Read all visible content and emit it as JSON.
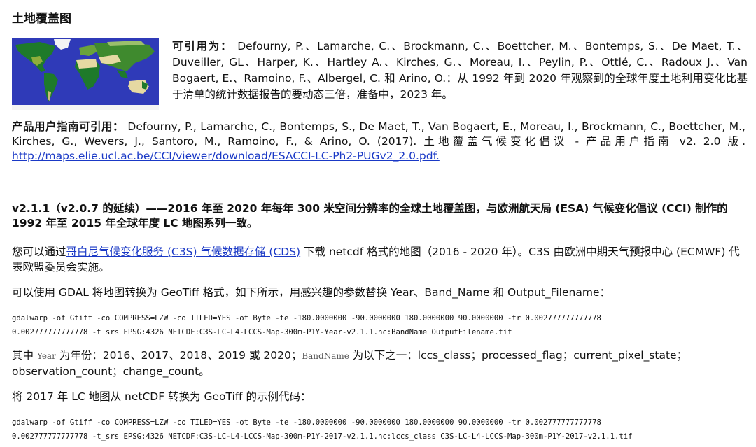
{
  "title": "土地覆盖图",
  "citation": {
    "label": "可引用为：",
    "text": "Defourny, P.、Lamarche, C.、Brockmann, C.、Boettcher, M.、Bontemps, S.、De Maet, T.、Duveiller, GL、Harper, K.、Hartley A.、Kirches, G.、Moreau, I.、Peylin, P.、Ottlé, C.、Radoux J.、Van Bogaert, E.、Ramoino, F.、Albergel, C. 和 Arino, O.：从 1992 年到 2020 年观察到的全球年度土地利用变化比基于清单的统计数据报告的要动态三倍，准备中，2023 年。"
  },
  "guide_citation": {
    "label": "产品用户指南可引用：",
    "text": " Defourny, P., Lamarche, C., Bontemps, S., De Maet, T., Van Bogaert, E., Moreau, I., Brockmann, C., Boettcher, M., Kirches, G., Wevers, J., Santoro, M., Ramoino, F., & Arino, O. (2017). 土地覆盖气候变化倡议 - 产品用户指南 v2. 2.0 版. ",
    "link": "http://maps.elie.ucl.ac.be/CCI/viewer/download/ESACCI-LC-Ph2-PUGv2_2.0.pdf."
  },
  "heading": "v2.1.1（v2.0.7 的延续）——2016 年至 2020 年每年 300 米空间分辨率的全球土地覆盖图，与欧洲航天局 (ESA) 气候变化倡议 (CCI) 制作的 1992 年至 2015 年全球年度 LC 地图系列一致。",
  "download": {
    "prefix": "您可以通过",
    "link": "哥白尼气候变化服务 (C3S) 气候数据存储 (CDS)",
    "suffix": " 下载 netcdf 格式的地图（2016 - 2020 年）。C3S 由欧洲中期天气预报中心 (ECMWF) 代表欧盟委员会实施。"
  },
  "gdal_intro": "可以使用 GDAL 将地图转换为 GeoTiff 格式，如下所示，用感兴趣的参数替换 Year、Band_Name 和 Output_Filename：",
  "code1": {
    "line1": "gdalwarp -of Gtiff -co COMPRESS=LZW -co TILED=YES -ot Byte -te -180.0000000 -90.0000000 180.0000000 90.0000000 -tr 0.002777777777778",
    "line2": "0.002777777777778 -t_srs EPSG:4326 NETCDF:C3S-LC-L4-LCCS-Map-300m-P1Y-Year-v2.1.1.nc:BandName OutputFilename.tif"
  },
  "params": {
    "p1": "其中 ",
    "year_var": "Year",
    "p2": " 为年份：2016、2017、2018、2019 或 2020；",
    "band_var": "BandName",
    "p3": " 为以下之一：lccs_class；processed_flag；current_pixel_state；observation_count；change_count。"
  },
  "example_intro": "将 2017 年 LC 地图从 netCDF 转换为 GeoTiff 的示例代码：",
  "code2": {
    "line1": "gdalwarp -of Gtiff -co COMPRESS=LZW -co TILED=YES -ot Byte -te -180.0000000 -90.0000000 180.0000000 90.0000000 -tr 0.002777777777778",
    "line2": "0.002777777777778 -t_srs EPSG:4326 NETCDF:C3S-LC-L4-LCCS-Map-300m-P1Y-2017-v2.1.1.nc:lccs_class C3S-LC-L4-LCCS-Map-300m-P1Y-2017-v2.1.1.tif"
  },
  "colors": {
    "ocean": "#2f3ab8",
    "land_green": "#1e7a2a",
    "desert": "#e6d9a2",
    "ice": "#f4f4f4",
    "link": "#1a39c6"
  }
}
